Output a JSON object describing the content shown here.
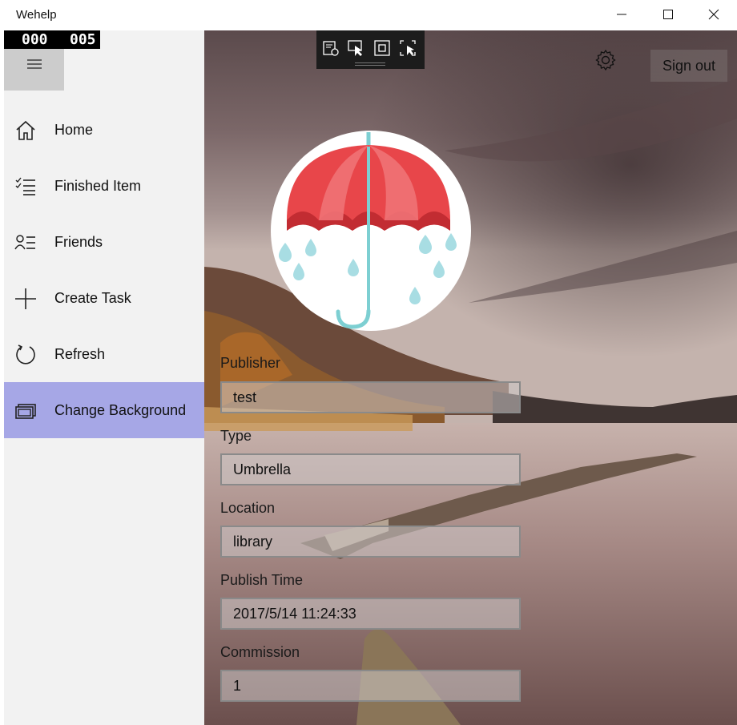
{
  "window": {
    "title": "Wehelp"
  },
  "counter": {
    "left": "000",
    "right": "005"
  },
  "nav": {
    "items": [
      {
        "label": "Home",
        "icon": "home-icon"
      },
      {
        "label": "Finished Item",
        "icon": "checklist-icon"
      },
      {
        "label": "Friends",
        "icon": "people-list-icon"
      },
      {
        "label": "Create Task",
        "icon": "plus-icon"
      },
      {
        "label": "Refresh",
        "icon": "refresh-icon"
      },
      {
        "label": "Change Background",
        "icon": "slideshow-icon",
        "selected": true
      }
    ]
  },
  "header": {
    "sign_out_label": "Sign out"
  },
  "form": {
    "publisher_label": "Publisher",
    "publisher_value": "test",
    "type_label": "Type",
    "type_value": "Umbrella",
    "location_label": "Location",
    "location_value": "library",
    "publish_time_label": "Publish Time",
    "publish_time_value": "2017/5/14 11:24:33",
    "commission_label": "Commission",
    "commission_value": "1"
  },
  "colors": {
    "selected_nav": "#a6a7e6",
    "pane": "#f2f2f2",
    "umbrella_red": "#e8464a",
    "drop_blue": "#a8dde3"
  }
}
